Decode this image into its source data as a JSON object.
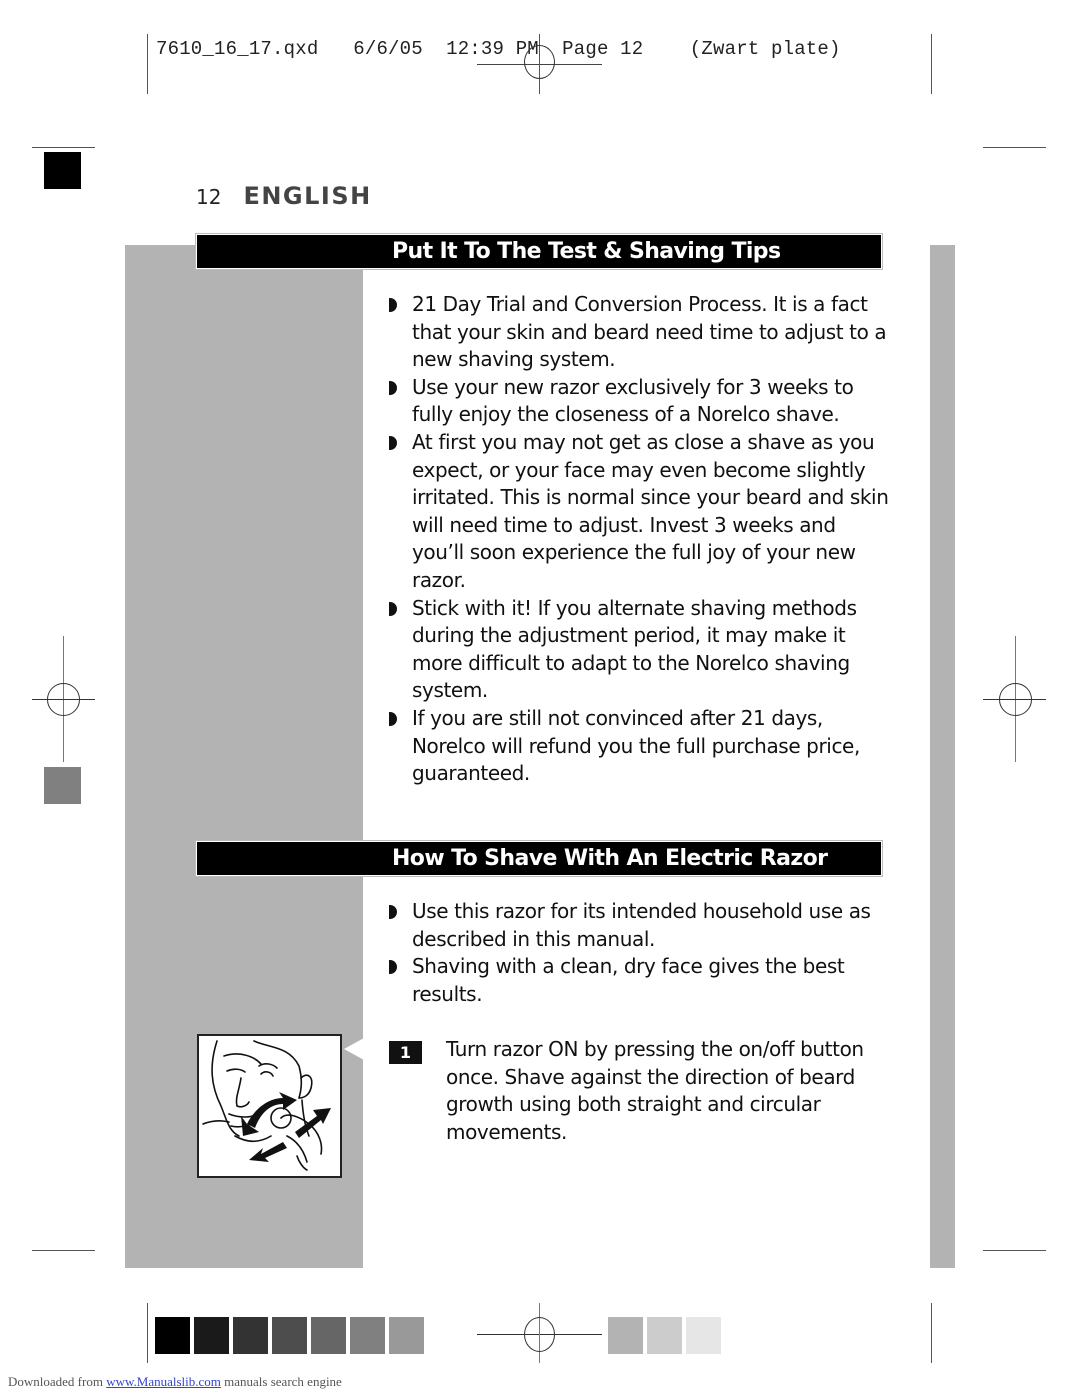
{
  "slug": {
    "filename": "7610_16_17.qxd",
    "date": "6/6/05",
    "time": "12:39 PM",
    "page": "Page 12",
    "plate": "(Zwart plate)"
  },
  "header": {
    "page_number": "12",
    "language": "ENGLISH"
  },
  "sections": [
    {
      "title": "Put It To The Test & Shaving Tips",
      "bullets": [
        "21 Day Trial and Conversion Process. It is a fact that your skin and beard need time to adjust to a new shaving system.",
        "Use your new razor exclusively for 3 weeks to fully enjoy the closeness of a Norelco shave.",
        "At first you may not get as close a shave as you expect, or your face may even become slightly irritated. This is normal since your beard and skin will need time to adjust. Invest 3 weeks and you’ll soon experience the full joy of your new razor.",
        "Stick with it! If you alternate shaving methods during the adjustment period, it may make it more difficult to adapt to the Norelco shaving system.",
        "If you are still not convinced after 21 days, Norelco will refund you the full purchase price, guaranteed."
      ]
    },
    {
      "title": "How To Shave With An Electric Razor",
      "bullets": [
        "Use this razor for its intended household use as described in this manual.",
        "Shaving with a clean, dry face gives the best results."
      ],
      "steps": [
        {
          "number": "1",
          "text": "Turn razor ON by pressing the on/off button once. Shave against the direction of beard growth using both straight and circular movements."
        }
      ]
    }
  ],
  "illustration": {
    "icon": "man-shaving-illustration"
  },
  "color_bar": {
    "left_swatches": [
      "#000000",
      "#1a1a1a",
      "#333333",
      "#4d4d4d",
      "#666666",
      "#808080",
      "#999999"
    ],
    "right_swatches": [
      "#b3b3b3",
      "#cccccc",
      "#e6e6e6"
    ]
  },
  "footer": {
    "prefix": "Downloaded from",
    "link": "www.Manualslib.com",
    "suffix": "manuals search engine"
  }
}
